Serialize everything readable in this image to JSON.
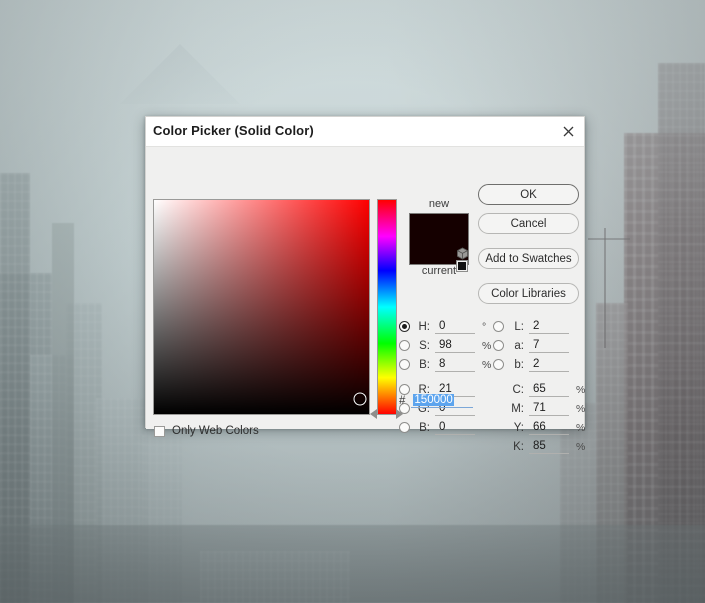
{
  "dialog": {
    "title": "Color Picker (Solid Color)",
    "close_icon": "close-icon"
  },
  "buttons": {
    "ok": "OK",
    "cancel": "Cancel",
    "add_to_swatches": "Add to Swatches",
    "color_libraries": "Color Libraries"
  },
  "preview": {
    "new_label": "new",
    "current_label": "current",
    "new_color": "#150000",
    "current_color": "#150000"
  },
  "picker": {
    "hue_base_color": "#ff0000",
    "sv_cursor_x_pct": 96,
    "sv_cursor_y_pct": 93,
    "hue_marker_pct": 99
  },
  "hsb": [
    {
      "key": "H",
      "label": "H:",
      "value": "0",
      "unit": "°",
      "selected": true
    },
    {
      "key": "S",
      "label": "S:",
      "value": "98",
      "unit": "%",
      "selected": false
    },
    {
      "key": "B",
      "label": "B:",
      "value": "8",
      "unit": "%",
      "selected": false
    }
  ],
  "rgb": [
    {
      "key": "R",
      "label": "R:",
      "value": "21",
      "unit": "",
      "selected": false
    },
    {
      "key": "G",
      "label": "G:",
      "value": "0",
      "unit": "",
      "selected": false
    },
    {
      "key": "B",
      "label": "B:",
      "value": "0",
      "unit": "",
      "selected": false
    }
  ],
  "lab": [
    {
      "key": "L",
      "label": "L:",
      "value": "2",
      "unit": "",
      "selected": false
    },
    {
      "key": "a",
      "label": "a:",
      "value": "7",
      "unit": "",
      "selected": false
    },
    {
      "key": "b",
      "label": "b:",
      "value": "2",
      "unit": "",
      "selected": false
    }
  ],
  "cmyk": [
    {
      "key": "C",
      "label": "C:",
      "value": "65",
      "unit": "%"
    },
    {
      "key": "M",
      "label": "M:",
      "value": "71",
      "unit": "%"
    },
    {
      "key": "Y",
      "label": "Y:",
      "value": "66",
      "unit": "%"
    },
    {
      "key": "K",
      "label": "K:",
      "value": "85",
      "unit": "%"
    }
  ],
  "hex": {
    "prefix": "#",
    "value": "150000",
    "selected": true
  },
  "web_colors": {
    "label": "Only Web Colors",
    "checked": false
  },
  "icons": {
    "gamut_warning": "gamut-warning-icon",
    "web_safe": "web-safe-icon"
  },
  "colors": {
    "accent_selection": "#5ca4ee",
    "dialog_bg": "#f0f0ef",
    "titlebar_bg": "#ffffff"
  }
}
